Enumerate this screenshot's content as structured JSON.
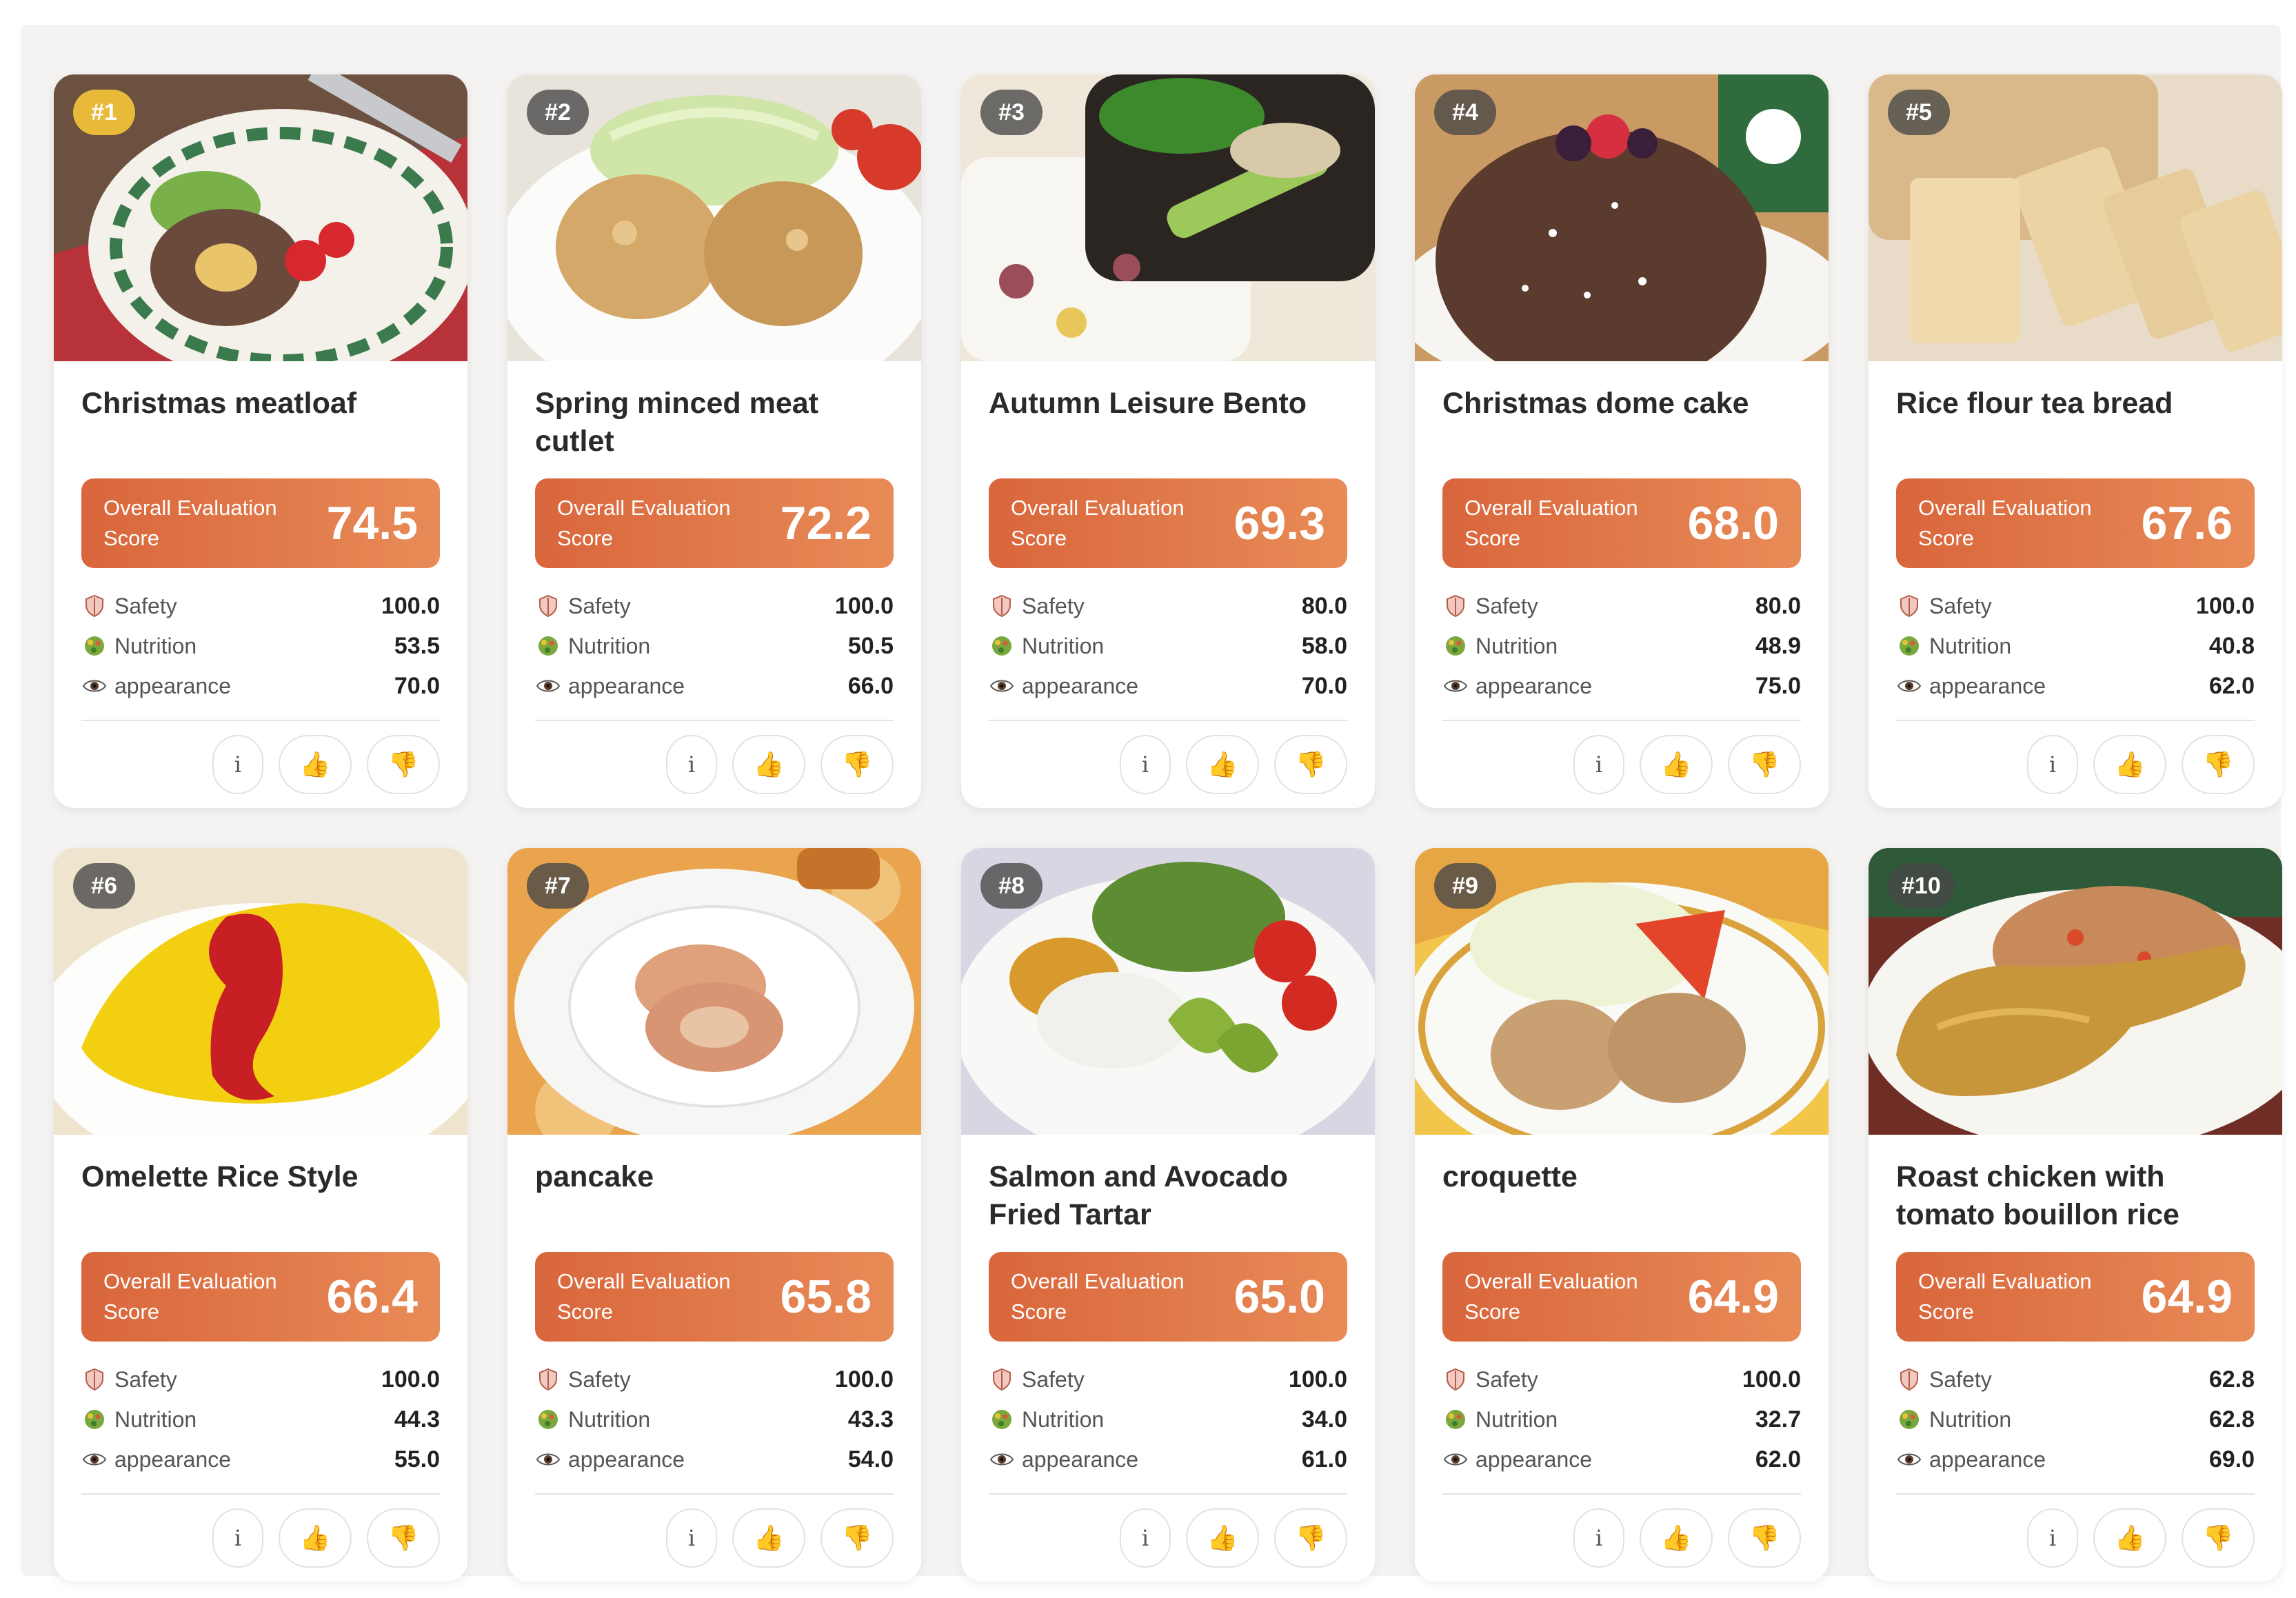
{
  "score_label": "Overall Evaluation Score",
  "metric_labels": {
    "safety": "Safety",
    "nutrition": "Nutrition",
    "appearance": "appearance"
  },
  "icons": {
    "safety": "shield-icon",
    "nutrition": "nutrition-ball-icon",
    "appearance": "eye-icon",
    "info": "info-icon",
    "like": "thumbs-up-icon",
    "dislike": "thumbs-down-icon"
  },
  "buttons": {
    "info_label": "i",
    "like_glyph": "👍",
    "dislike_glyph": "👎"
  },
  "colors": {
    "score_gradient_start": "#d9663c",
    "score_gradient_end": "#e88b57",
    "rank_gold": "#e9b93a",
    "rank_dark": "#464646"
  },
  "cards": [
    {
      "rank": "#1",
      "title": "Christmas meatloaf",
      "score": "74.5",
      "safety": "100.0",
      "nutrition": "53.5",
      "appearance": "70.0",
      "photo": "meatloaf-photo"
    },
    {
      "rank": "#2",
      "title": "Spring minced meat cutlet",
      "score": "72.2",
      "safety": "100.0",
      "nutrition": "50.5",
      "appearance": "66.0",
      "photo": "cutlet-photo"
    },
    {
      "rank": "#3",
      "title": "Autumn Leisure Bento",
      "score": "69.3",
      "safety": "80.0",
      "nutrition": "58.0",
      "appearance": "70.0",
      "photo": "bento-photo"
    },
    {
      "rank": "#4",
      "title": "Christmas dome cake",
      "score": "68.0",
      "safety": "80.0",
      "nutrition": "48.9",
      "appearance": "75.0",
      "photo": "dome-cake-photo"
    },
    {
      "rank": "#5",
      "title": "Rice flour tea bread",
      "score": "67.6",
      "safety": "100.0",
      "nutrition": "40.8",
      "appearance": "62.0",
      "photo": "tea-bread-photo"
    },
    {
      "rank": "#6",
      "title": "Omelette Rice Style",
      "score": "66.4",
      "safety": "100.0",
      "nutrition": "44.3",
      "appearance": "55.0",
      "photo": "omelette-photo"
    },
    {
      "rank": "#7",
      "title": "pancake",
      "score": "65.8",
      "safety": "100.0",
      "nutrition": "43.3",
      "appearance": "54.0",
      "photo": "pancake-photo"
    },
    {
      "rank": "#8",
      "title": "Salmon and Avocado Fried Tartar",
      "score": "65.0",
      "safety": "100.0",
      "nutrition": "34.0",
      "appearance": "61.0",
      "photo": "salmon-avocado-photo"
    },
    {
      "rank": "#9",
      "title": "croquette",
      "score": "64.9",
      "safety": "100.0",
      "nutrition": "32.7",
      "appearance": "62.0",
      "photo": "croquette-photo"
    },
    {
      "rank": "#10",
      "title": "Roast chicken with tomato bouillon rice",
      "score": "64.9",
      "safety": "62.8",
      "nutrition": "62.8",
      "appearance": "69.0",
      "photo": "roast-chicken-photo"
    }
  ]
}
